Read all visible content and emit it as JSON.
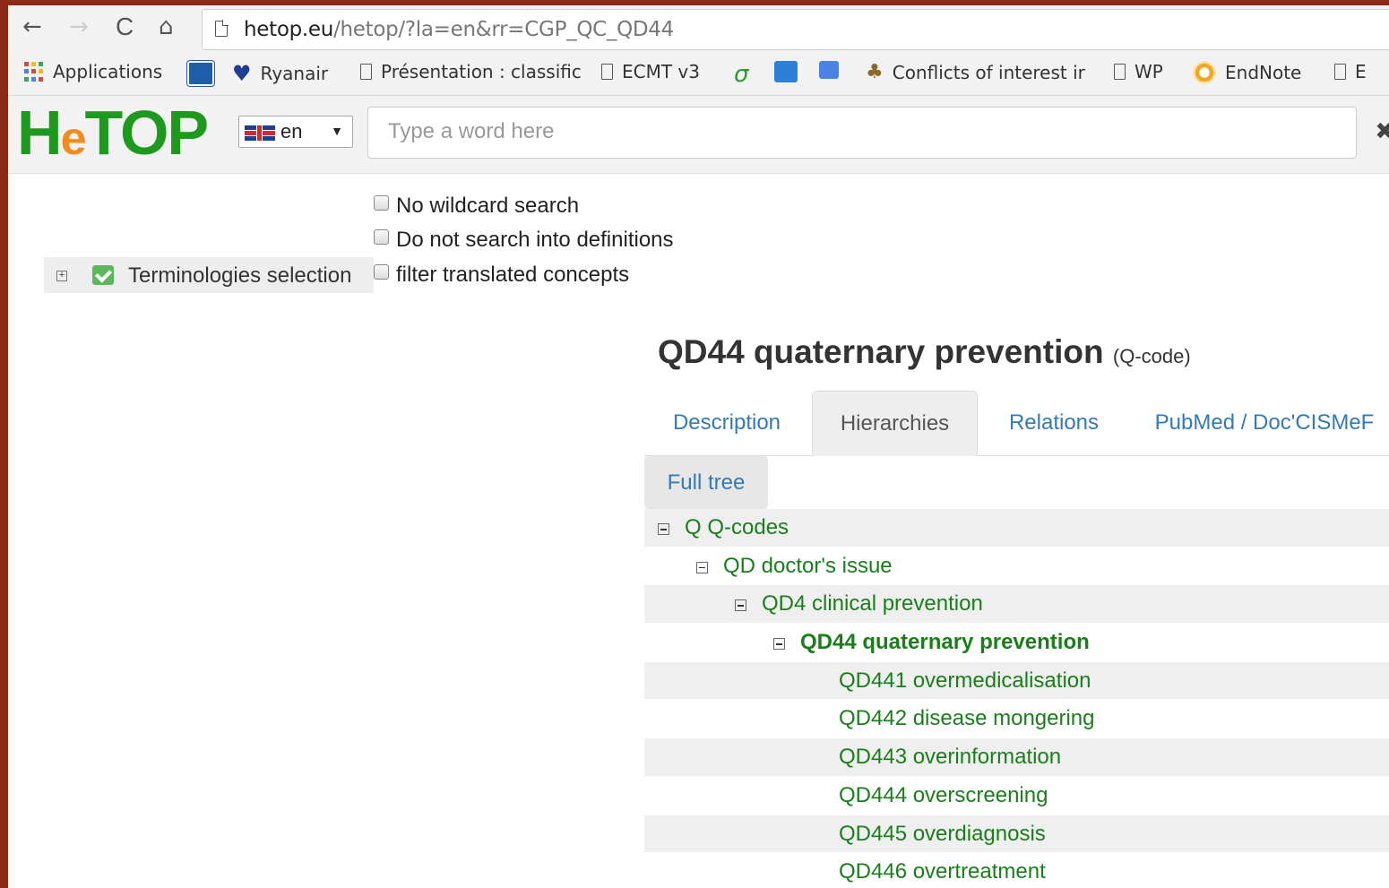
{
  "browser": {
    "url_host": "hetop.eu",
    "url_path": "/hetop/?la=en&rr=CGP_QC_QD44",
    "back": "←",
    "forward": "→",
    "reload": "C",
    "home": "⌂"
  },
  "bookmarks": {
    "apps": "Applications",
    "ryanair": "Ryanair",
    "presentation": "Présentation : classific",
    "ecmt": "ECMT v3",
    "conflicts": "Conflicts of interest ir",
    "wp": "WP",
    "endnote": "EndNote",
    "e": "E"
  },
  "header": {
    "logo_h": "H",
    "logo_e": "e",
    "logo_rest": "TOP",
    "lang": "en",
    "lang_caret": "▼",
    "search_placeholder": "Type a word here",
    "clear": "✖"
  },
  "options": {
    "no_wildcard": "No wildcard search",
    "no_definitions": "Do not search into definitions",
    "filter_translated": "filter translated concepts",
    "terminologies": "Terminologies selection"
  },
  "concept": {
    "title": "QD44 quaternary prevention",
    "type": "(Q-code)"
  },
  "tabs": {
    "description": "Description",
    "hierarchies": "Hierarchies",
    "relations": "Relations",
    "pubmed": "PubMed / Doc'CISMeF"
  },
  "full_tree": "Full tree",
  "tree": [
    {
      "label": "Q Q-codes"
    },
    {
      "label": "QD doctor's issue"
    },
    {
      "label": "QD4 clinical prevention"
    },
    {
      "label": "QD44 quaternary prevention"
    },
    {
      "label": "QD441 overmedicalisation"
    },
    {
      "label": "QD442 disease mongering"
    },
    {
      "label": "QD443 overinformation"
    },
    {
      "label": "QD444 overscreening"
    },
    {
      "label": "QD445 overdiagnosis"
    },
    {
      "label": "QD446 overtreatment"
    }
  ]
}
